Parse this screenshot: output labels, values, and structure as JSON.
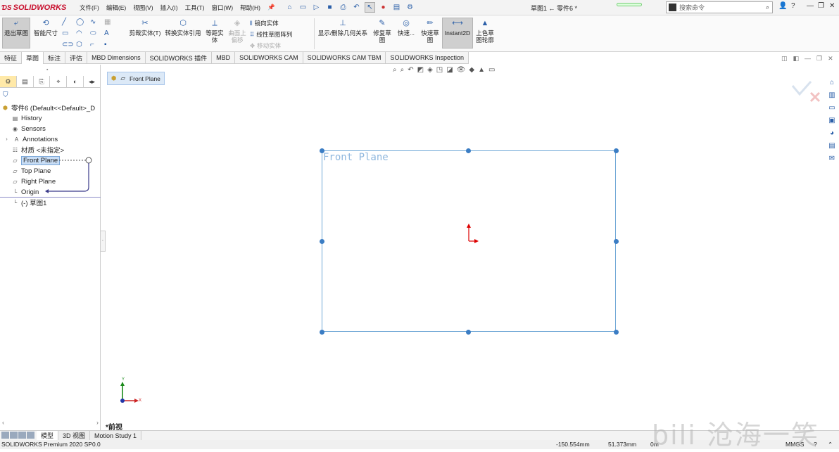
{
  "app": {
    "logo": "SOLIDWORKS",
    "doc_title": "草图1 ← 零件6 *"
  },
  "menu": [
    "文件(F)",
    "编辑(E)",
    "视图(V)",
    "插入(I)",
    "工具(T)",
    "窗口(W)",
    "帮助(H)"
  ],
  "search": {
    "placeholder": "搜索命令"
  },
  "ribbon": {
    "exit_sketch": "退出草图",
    "smart_dim": "智能尺寸",
    "trim": "剪裁实体(T)",
    "convert": "转换实体引用",
    "offset": "等距实体",
    "surface_offset": "曲面上偏移",
    "mirror": "镜向实体",
    "linear_pattern": "线性草图阵列",
    "move": "移动实体",
    "show_relations": "显示/删除几何关系",
    "repair": "修复草图",
    "quick_snap": "快速...",
    "rapid_sketch": "快速草图",
    "instant2d": "Instant2D",
    "shaded_sketch": "上色草图轮廓"
  },
  "cm_tabs": [
    "特征",
    "草图",
    "标注",
    "评估",
    "MBD Dimensions",
    "SOLIDWORKS 插件",
    "MBD",
    "SOLIDWORKS CAM",
    "SOLIDWORKS CAM TBM",
    "SOLIDWORKS Inspection"
  ],
  "cm_active_tab": "草图",
  "tree": {
    "root": "零件6  (Default<<Default>_D",
    "items": [
      "History",
      "Sensors",
      "Annotations",
      "材质 <未指定>",
      "Front Plane",
      "Top Plane",
      "Right Plane",
      "Origin",
      "(-) 草图1"
    ]
  },
  "breadcrumb": "Front Plane",
  "sketch": {
    "plane_label": "Front Plane"
  },
  "view_label": "*前视",
  "triad": {
    "x": "X",
    "y": "Y"
  },
  "bottom_tabs": [
    "模型",
    "3D 视图",
    "Motion Study 1"
  ],
  "status": {
    "product": "SOLIDWORKS Premium 2020 SP0.0",
    "x": "-150.554mm",
    "y": "51.373mm",
    "z": "0m",
    "units": "MMGS"
  },
  "watermark": "bili 沧海一笑",
  "colors": {
    "accent": "#2b5fa8",
    "sketch_line": "#6fa7d6",
    "handle": "#3b7dc4",
    "selection": "#c8ddf5"
  }
}
